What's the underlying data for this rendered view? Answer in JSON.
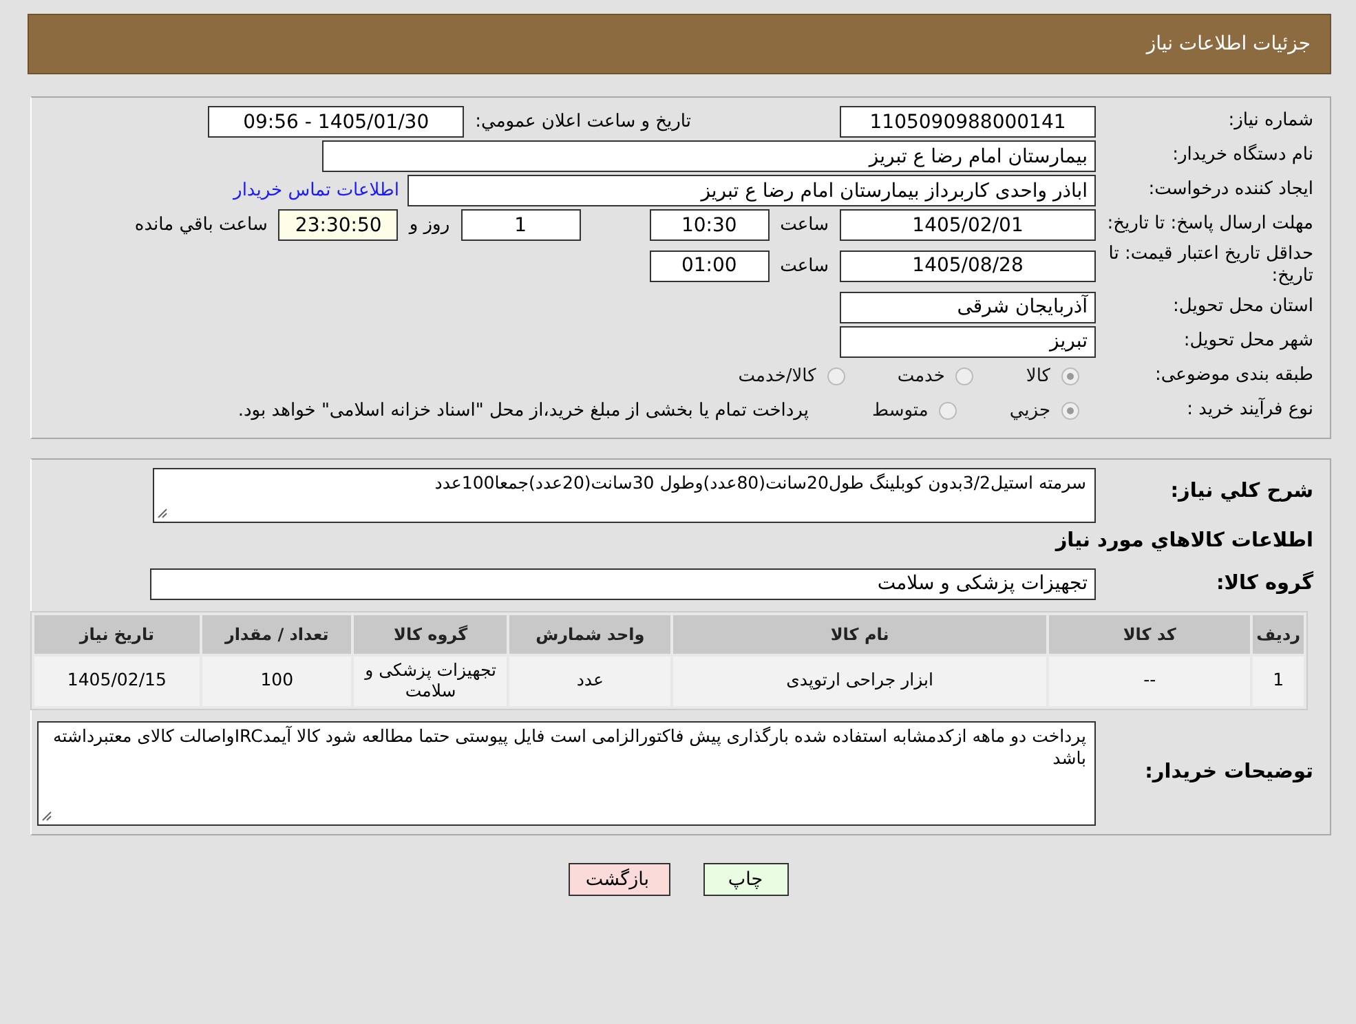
{
  "header": {
    "title": "جزئیات اطلاعات نیاز"
  },
  "need_number": {
    "label": "شماره نیاز:",
    "value": "1105090988000141"
  },
  "announce": {
    "label": "تاريخ و ساعت اعلان عمومي:",
    "value": "1405/01/30 - 09:56"
  },
  "buyer": {
    "label": "نام دستگاه خریدار:",
    "value": "بیمارستان امام رضا  ع  تبریز"
  },
  "creator": {
    "label": "ایجاد کننده درخواست:",
    "value": "اباذر واحدی کاربرداز بیمارستان امام رضا  ع  تبریز",
    "link": "اطلاعات تماس خریدار"
  },
  "deadline": {
    "label": "مهلت ارسال پاسخ: تا تاریخ:",
    "date": "1405/02/01",
    "time_label": "ساعت",
    "time": "10:30",
    "days": "1",
    "days_label": "روز و",
    "remaining": "23:30:50",
    "remaining_label": "ساعت باقي مانده"
  },
  "validity": {
    "label": "حداقل تاریخ اعتبار قیمت: تا تاریخ:",
    "date": "1405/08/28",
    "time_label": "ساعت",
    "time": "01:00"
  },
  "province": {
    "label": "استان محل تحویل:",
    "value": "آذربایجان شرقی"
  },
  "city": {
    "label": "شهر محل تحویل:",
    "value": "تبریز"
  },
  "category": {
    "label": "طبقه بندی موضوعی:",
    "options": [
      {
        "label": "کالا",
        "selected": true
      },
      {
        "label": "خدمت",
        "selected": false
      },
      {
        "label": "کالا/خدمت",
        "selected": false
      }
    ]
  },
  "process": {
    "label": "نوع فرآیند خرید :",
    "options": [
      {
        "label": "جزيي",
        "selected": true
      },
      {
        "label": "متوسط",
        "selected": false
      }
    ],
    "note": "پرداخت تمام یا بخشی از مبلغ خرید،از محل \"اسناد خزانه اسلامی\" خواهد بود."
  },
  "description": {
    "label": "شرح کلي نياز:",
    "value": "سرمته  استیل3/2بدون کوبلینگ طول20سانت(80عدد)وطول 30سانت(20عدد)جمعا100عدد"
  },
  "goods_heading": "اطلاعات کالاهاي مورد نياز",
  "goods_group": {
    "label": "گروه کالا:",
    "value": "تجهیزات پزشکی و سلامت"
  },
  "table": {
    "columns": [
      "ردیف",
      "کد کالا",
      "نام کالا",
      "واحد شمارش",
      "گروه کالا",
      "تعداد / مقدار",
      "تاریخ نیاز"
    ],
    "rows": [
      [
        "1",
        "--",
        "ابزار جراحی ارتوپدی",
        "عدد",
        "تجهیزات پزشکی و سلامت",
        "100",
        "1405/02/15"
      ]
    ]
  },
  "buyer_notes": {
    "label": "توضیحات خریدار:",
    "value": "پرداخت دو ماهه ازکدمشابه استفاده شده بارگذاری پیش فاکتورالزامی است فایل پیوستی حتما مطالعه شود کالا آیمدIRCواصالت کالای معتبرداشته باشد"
  },
  "buttons": [
    {
      "kind": "print",
      "label": "چاپ"
    },
    {
      "kind": "back",
      "label": "بازگشت"
    }
  ]
}
